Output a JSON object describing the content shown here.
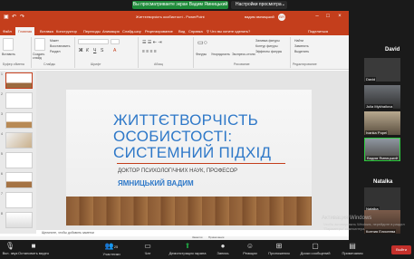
{
  "banner": {
    "share_status": "Вы просматриваете экран Вадим Ямницький",
    "view_options": "Настройки просмотра",
    "chevron": "⌄"
  },
  "powerpoint": {
    "title": "Життєтворчість особистості - PowerPoint",
    "user": "вадим ямницький",
    "avatar_initials": "ВЯ",
    "tabs": [
      "Файл",
      "Главная",
      "Вставка",
      "Конструктор",
      "Переходы",
      "Анимация",
      "Слайд-шоу",
      "Рецензирование",
      "Вид",
      "Справка",
      "Что вы хотите сделать?",
      "Поделиться"
    ],
    "ribbon_groups": [
      "Буфер обмена",
      "Слайды",
      "Шрифт",
      "Абзац",
      "Рисование",
      "Редактирование"
    ],
    "ribbon_buttons": {
      "paste": "Вставить",
      "new_slide": "Создать слайд",
      "layout": "Макет",
      "reset": "Восстановить",
      "section": "Раздел",
      "shapes": "Фигуры",
      "arrange": "Упорядочить",
      "quick_styles": "Экспресс-стили",
      "shape_fill": "Заливка фигуры",
      "shape_outline": "Контур фигуры",
      "shape_effects": "Эффекты фигуры",
      "find": "Найти",
      "replace": "Заменить",
      "select": "Выделить"
    },
    "slide_numbers": [
      "1",
      "2",
      "3",
      "4",
      "5",
      "6",
      "7",
      "8"
    ],
    "slide": {
      "title_line1": "ЖИТТЄТВОРЧІСТЬ",
      "title_line2": "ОСОБИСТОСТІ:",
      "title_line3": "СИСТЕМНИЙ ПІДХІД",
      "subtitle": "ДОКТОР ПСИХОЛОГІЧНИХ НАУК, ПРОФЕСОР",
      "author": "ЯМНИЦЬКИЙ ВАДИМ"
    },
    "notes_placeholder": "Щелкните, чтобы добавить заметки",
    "status_notes": "Заметки",
    "status_comments": "Примечания"
  },
  "gallery": {
    "participants": [
      {
        "name": "David"
      },
      {
        "name": "David"
      },
      {
        "name": "Julia Mykhailova"
      },
      {
        "name": "Ivanka Popel"
      },
      {
        "name": "Вадим Ямницький"
      },
      {
        "name": "Natalka"
      },
      {
        "name": "Natalka"
      },
      {
        "name": "Ксения Елисеева"
      }
    ]
  },
  "watermark": {
    "title": "Активация Windows",
    "body": "Чтобы активировать Windows, перейдите в раздел \"Параметры\" компьютера."
  },
  "toolbar": {
    "mute": "Вкл. звук",
    "video": "Остановить видео",
    "participants": "Участники",
    "participants_count": "25",
    "chat": "Чат",
    "share": "Демонстрация экрана",
    "record": "Запись",
    "reactions": "Реакции",
    "apps": "Приложения",
    "whiteboard": "Доски сообщений",
    "notes": "Примечания",
    "leave": "Выйти"
  },
  "colors": {
    "ppt_accent": "#c43e1c",
    "slide_title": "#2e78c8",
    "share_green": "#1f8b3a"
  }
}
